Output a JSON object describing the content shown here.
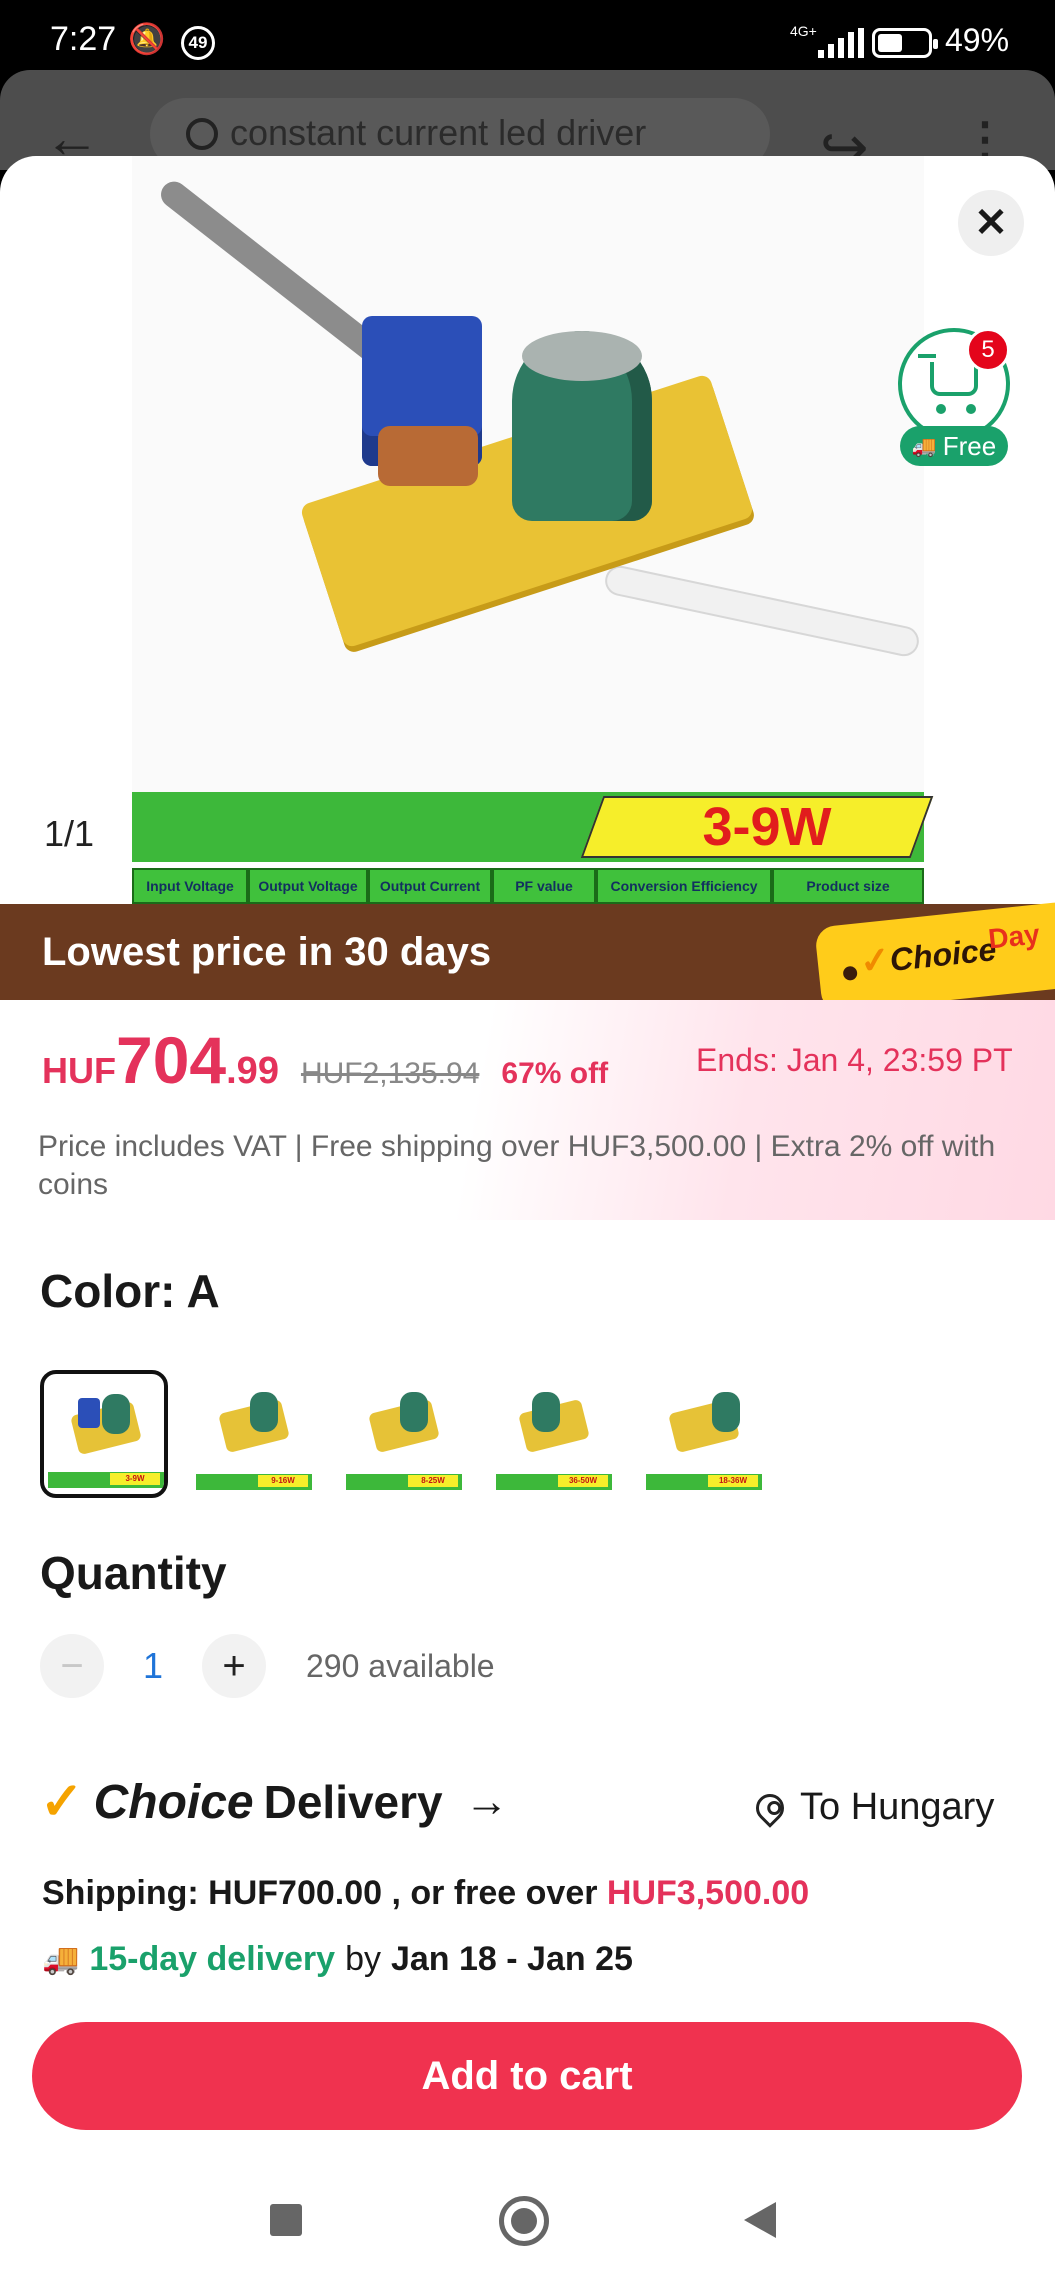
{
  "status_bar": {
    "time": "7:27",
    "notification_count": "49",
    "network": "4G+",
    "battery_percent": "49%",
    "battery_level": 0.49
  },
  "background_header": {
    "search_text": "constant current led driver"
  },
  "gallery": {
    "counter": "1/1",
    "banner_title": "3-9W",
    "banner_columns": [
      "Input Voltage",
      "Output Voltage",
      "Output Current",
      "PF value",
      "Conversion Efficiency",
      "Product size"
    ]
  },
  "cart": {
    "badge_count": "5",
    "free_label": "Free"
  },
  "promo_bar": {
    "label": "Lowest price in 30 days",
    "badge_choice": "Choice",
    "badge_day": "Day"
  },
  "price": {
    "currency": "HUF",
    "main": "704",
    "decimals": ".99",
    "original": "HUF2,135.94",
    "discount": "67% off",
    "ends": "Ends:  Jan 4, 23:59 PT",
    "note": "Price includes VAT | Free shipping over HUF3,500.00 | Extra 2% off with coins"
  },
  "color": {
    "label": "Color:  A",
    "options": [
      {
        "band": "3-9W",
        "selected": true
      },
      {
        "band": "9-16W",
        "selected": false
      },
      {
        "band": "8-25W",
        "selected": false
      },
      {
        "band": "36-50W",
        "selected": false
      },
      {
        "band": "18-36W",
        "selected": false
      }
    ]
  },
  "quantity": {
    "label": "Quantity",
    "minus": "−",
    "value": "1",
    "plus": "+",
    "available": "290 available"
  },
  "delivery": {
    "choice": "Choice",
    "title": "Delivery",
    "arrow": "→",
    "to": "To Hungary",
    "shipping_prefix": "Shipping: HUF700.00 , or free over ",
    "shipping_threshold": "HUF3,500.00",
    "eta_days": "15-day delivery",
    "eta_by": "by",
    "eta_range": "Jan 18 - Jan 25"
  },
  "actions": {
    "add_to_cart": "Add to cart",
    "close": "✕"
  },
  "colors": {
    "accent": "#f0324f",
    "price": "#e4325b",
    "green": "#1aa16b",
    "promo_bar": "#6b3a1f"
  }
}
